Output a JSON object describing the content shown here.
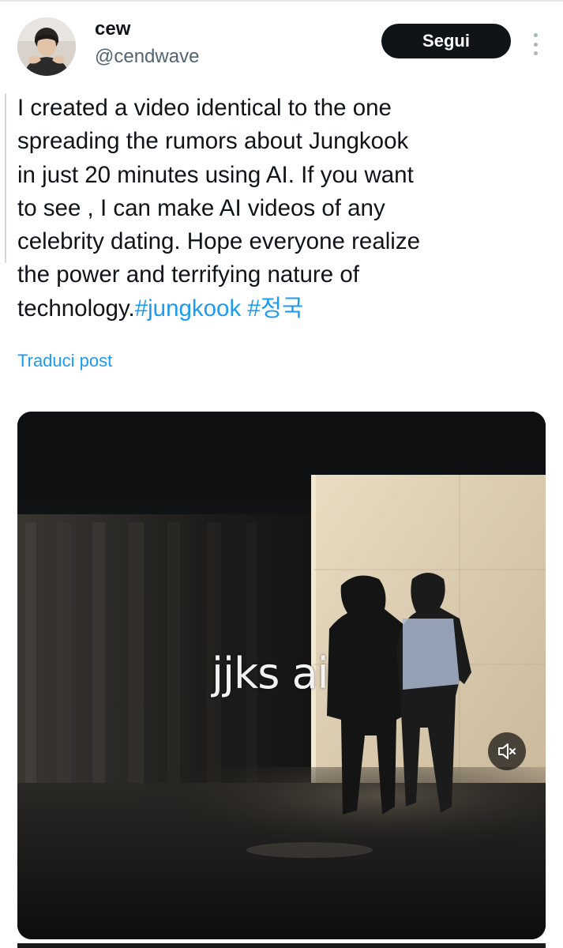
{
  "header": {
    "display_name": "cew",
    "handle": "@cendwave",
    "follow_label": "Segui",
    "more_icon": "more-vertical-icon"
  },
  "post": {
    "text": "I created a video identical to the one\nspreading the rumors about Jungkook\nin just 20 minutes using AI. If you want\nto see , I can make AI videos of any\ncelebrity dating. Hope everyone realize\nthe power and terrifying nature of\ntechnology.",
    "hashtags": [
      "#jungkook",
      "#정국"
    ],
    "translate_label": "Traduci post"
  },
  "media": {
    "type": "video",
    "caption": "jjks ai",
    "mute_icon": "volume-muted-icon"
  },
  "colors": {
    "link": "#1d9bf0",
    "text": "#0f1419",
    "secondary_text": "#536471",
    "button_bg": "#0f1419",
    "button_text": "#ffffff"
  }
}
